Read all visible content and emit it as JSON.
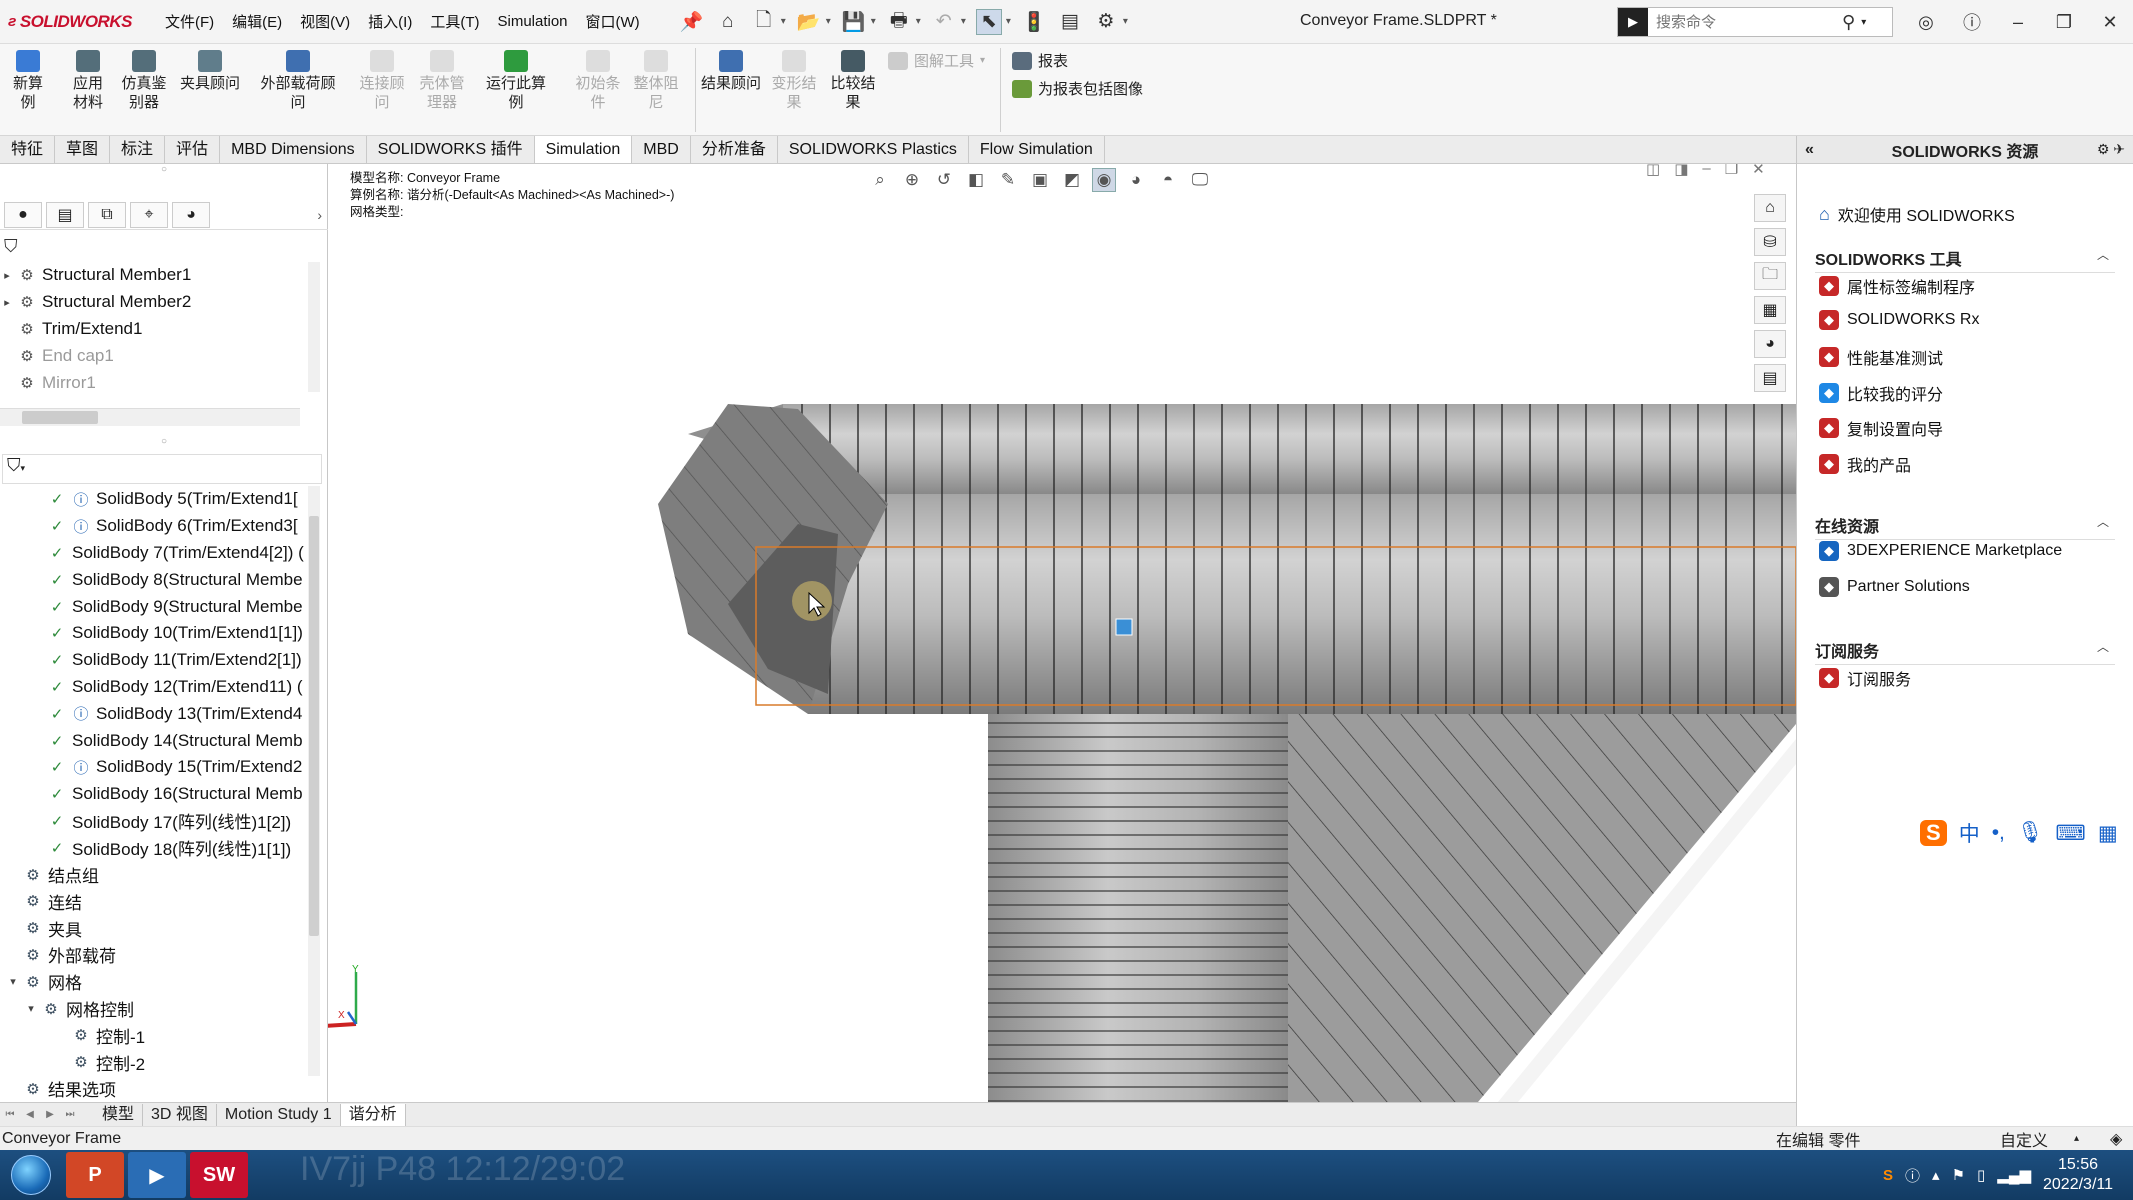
{
  "app": {
    "logo": "SOLIDWORKS",
    "document_title": "Conveyor Frame.SLDPRT *",
    "menu": [
      "文件(F)",
      "编辑(E)",
      "视图(V)",
      "插入(I)",
      "工具(T)",
      "Simulation",
      "窗口(W)"
    ],
    "search_placeholder": "搜索命令"
  },
  "ribbon": {
    "buttons": [
      {
        "label": "新算例",
        "color": "#3a7bd5",
        "enabled": true
      },
      {
        "label": "应用材料",
        "color": "#546e7a",
        "enabled": true
      },
      {
        "label": "仿真鉴别器",
        "color": "#546e7a",
        "enabled": true
      },
      {
        "label": "夹具顾问",
        "color": "#607d8b",
        "enabled": true
      },
      {
        "label": "外部载荷顾问",
        "color": "#3f6fb0",
        "enabled": true
      },
      {
        "label": "连接顾问",
        "color": "#bbb",
        "enabled": false
      },
      {
        "label": "壳体管理器",
        "color": "#bbb",
        "enabled": false
      },
      {
        "label": "运行此算例",
        "color": "#2e9b3e",
        "enabled": true
      },
      {
        "label": "初始条件",
        "color": "#bbb",
        "enabled": false
      },
      {
        "label": "整体阻尼",
        "color": "#bbb",
        "enabled": false
      },
      {
        "label": "结果顾问",
        "color": "#3f6fb0",
        "enabled": true
      },
      {
        "label": "变形结果",
        "color": "#bbb",
        "enabled": false
      },
      {
        "label": "比较结果",
        "color": "#455a64",
        "enabled": true
      }
    ],
    "small": [
      {
        "label": "图解工具",
        "enabled": false
      },
      {
        "label": "报表",
        "enabled": true
      },
      {
        "label": "为报表包括图像",
        "enabled": true
      }
    ]
  },
  "tabs": [
    "特征",
    "草图",
    "标注",
    "评估",
    "MBD Dimensions",
    "SOLIDWORKS 插件",
    "Simulation",
    "MBD",
    "分析准备",
    "SOLIDWORKS Plastics",
    "Flow Simulation"
  ],
  "active_tab": "Simulation",
  "feature_tree": [
    {
      "label": "Structural Member1",
      "dim": false,
      "expander": "▸"
    },
    {
      "label": "Structural Member2",
      "dim": false,
      "expander": "▸"
    },
    {
      "label": "Trim/Extend1",
      "dim": false,
      "expander": ""
    },
    {
      "label": "End cap1",
      "dim": true,
      "expander": ""
    },
    {
      "label": "Mirror1",
      "dim": true,
      "expander": ""
    }
  ],
  "sim_tree": [
    {
      "label": "SolidBody 5(Trim/Extend1[",
      "info": true,
      "indent": 2
    },
    {
      "label": "SolidBody 6(Trim/Extend3[",
      "info": true,
      "indent": 2
    },
    {
      "label": "SolidBody 7(Trim/Extend4[2]) (",
      "info": false,
      "indent": 2
    },
    {
      "label": "SolidBody 8(Structural Membe",
      "info": false,
      "indent": 2
    },
    {
      "label": "SolidBody 9(Structural Membe",
      "info": false,
      "indent": 2
    },
    {
      "label": "SolidBody 10(Trim/Extend1[1])",
      "info": false,
      "indent": 2
    },
    {
      "label": "SolidBody 11(Trim/Extend2[1])",
      "info": false,
      "indent": 2
    },
    {
      "label": "SolidBody 12(Trim/Extend11) (",
      "info": false,
      "indent": 2
    },
    {
      "label": "SolidBody 13(Trim/Extend4",
      "info": true,
      "indent": 2
    },
    {
      "label": "SolidBody 14(Structural Memb",
      "info": false,
      "indent": 2
    },
    {
      "label": "SolidBody 15(Trim/Extend2",
      "info": true,
      "indent": 2
    },
    {
      "label": "SolidBody 16(Structural Memb",
      "info": false,
      "indent": 2
    },
    {
      "label": "SolidBody 17(阵列(线性)1[2])",
      "info": false,
      "indent": 2
    },
    {
      "label": "SolidBody 18(阵列(线性)1[1])",
      "info": false,
      "indent": 2
    },
    {
      "label": "结点组",
      "info": false,
      "indent": 1
    },
    {
      "label": "连结",
      "info": false,
      "indent": 1
    },
    {
      "label": "夹具",
      "info": false,
      "indent": 1
    },
    {
      "label": "外部载荷",
      "info": false,
      "indent": 1
    },
    {
      "label": "网格",
      "info": false,
      "indent": 0
    },
    {
      "label": "网格控制",
      "info": false,
      "indent": 1
    },
    {
      "label": "控制-1",
      "info": false,
      "indent": 3
    },
    {
      "label": "控制-2",
      "info": false,
      "indent": 3
    },
    {
      "label": "结果选项",
      "info": false,
      "indent": 1
    }
  ],
  "viewport": {
    "model_name": "模型名称: Conveyor Frame",
    "study_name": "算例名称: 谐分析(-Default<As Machined><As Machined>-)",
    "mesh_type": "网格类型:",
    "triad_x": "X",
    "triad_y": "Y"
  },
  "bottom_tabs": [
    "模型",
    "3D 视图",
    "Motion Study 1",
    "谐分析"
  ],
  "active_bottom_tab": "谐分析",
  "status": {
    "left": "Conveyor Frame",
    "mode": "在编辑 零件",
    "custom": "自定义"
  },
  "resources": {
    "title": "SOLIDWORKS 资源",
    "welcome": "欢迎使用 SOLIDWORKS",
    "sections": [
      {
        "title": "SOLIDWORKS 工具",
        "items": [
          {
            "label": "属性标签编制程序",
            "color": "#c62828"
          },
          {
            "label": "SOLIDWORKS Rx",
            "color": "#c62828"
          },
          {
            "label": "性能基准测试",
            "color": "#c62828"
          },
          {
            "label": "比较我的评分",
            "color": "#1e88e5"
          },
          {
            "label": "复制设置向导",
            "color": "#c62828"
          },
          {
            "label": "我的产品",
            "color": "#c62828"
          }
        ]
      },
      {
        "title": "在线资源",
        "items": [
          {
            "label": "3DEXPERIENCE Marketplace",
            "color": "#1565c0"
          },
          {
            "label": "Partner Solutions",
            "color": "#555"
          }
        ]
      },
      {
        "title": "订阅服务",
        "items": [
          {
            "label": "订阅服务",
            "color": "#c62828"
          }
        ]
      }
    ]
  },
  "ime": {
    "label": "中"
  },
  "taskbar": {
    "time": "15:56",
    "date": "2022/3/11",
    "apps": [
      {
        "label": "P",
        "color": "#d24726"
      },
      {
        "label": "▶",
        "color": "#2a6db5"
      },
      {
        "label": "SW",
        "color": "#c8102e"
      }
    ],
    "watermark": "IV7jj P48 12:12/29:02"
  }
}
